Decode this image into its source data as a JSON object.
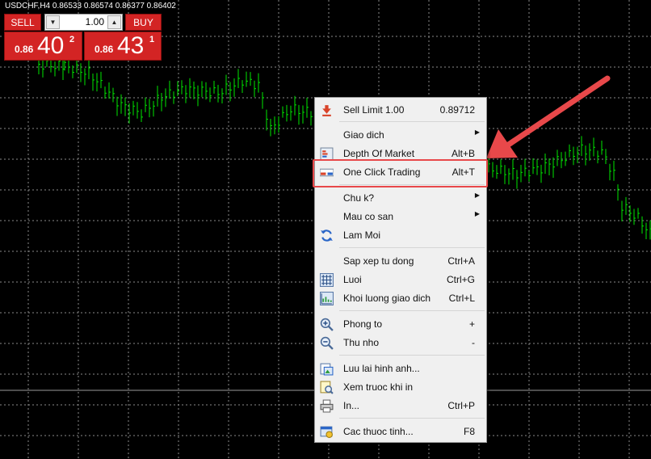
{
  "chart": {
    "title": "USDCHF,H4  0.86533 0.86574 0.86377 0.86402",
    "candle_color": "#00e600",
    "grid_color": "#8a8a8a",
    "background": "#000000"
  },
  "trade_panel": {
    "sell_label": "SELL",
    "buy_label": "BUY",
    "lot_value": "1.00",
    "sell_price": {
      "prefix": "0.86",
      "big": "40",
      "sup": "2"
    },
    "buy_price": {
      "prefix": "0.86",
      "big": "43",
      "sup": "1"
    },
    "button_color": "#d32424"
  },
  "context_menu": {
    "items": [
      {
        "label": "Sell Limit 1.00",
        "shortcut": "0.89712",
        "icon": "sell-limit-icon"
      },
      {
        "label": "Giao dich",
        "submenu": true
      },
      {
        "label": "Depth Of Market",
        "shortcut": "Alt+B",
        "icon": "depth-of-market-icon"
      },
      {
        "label": "One Click Trading",
        "shortcut": "Alt+T",
        "icon": "one-click-trading-icon"
      },
      {
        "label": "Chu k?",
        "submenu": true
      },
      {
        "label": "Mau co san",
        "submenu": true
      },
      {
        "label": "Lam Moi",
        "icon": "refresh-icon"
      },
      {
        "label": "Sap xep tu dong",
        "shortcut": "Ctrl+A"
      },
      {
        "label": "Luoi",
        "shortcut": "Ctrl+G",
        "icon": "grid-icon"
      },
      {
        "label": "Khoi luong giao dich",
        "shortcut": "Ctrl+L",
        "icon": "volume-icon"
      },
      {
        "label": "Phong to",
        "shortcut": "+",
        "icon": "zoom-in-icon"
      },
      {
        "label": "Thu nho",
        "shortcut": "-",
        "icon": "zoom-out-icon"
      },
      {
        "label": "Luu lai hinh anh...",
        "icon": "save-image-icon"
      },
      {
        "label": "Xem truoc khi in",
        "icon": "print-preview-icon"
      },
      {
        "label": "In...",
        "shortcut": "Ctrl+P",
        "icon": "print-icon"
      },
      {
        "label": "Cac thuoc tinh...",
        "shortcut": "F8",
        "icon": "properties-icon"
      }
    ]
  },
  "annotation": {
    "highlight_color": "#e8484a"
  }
}
